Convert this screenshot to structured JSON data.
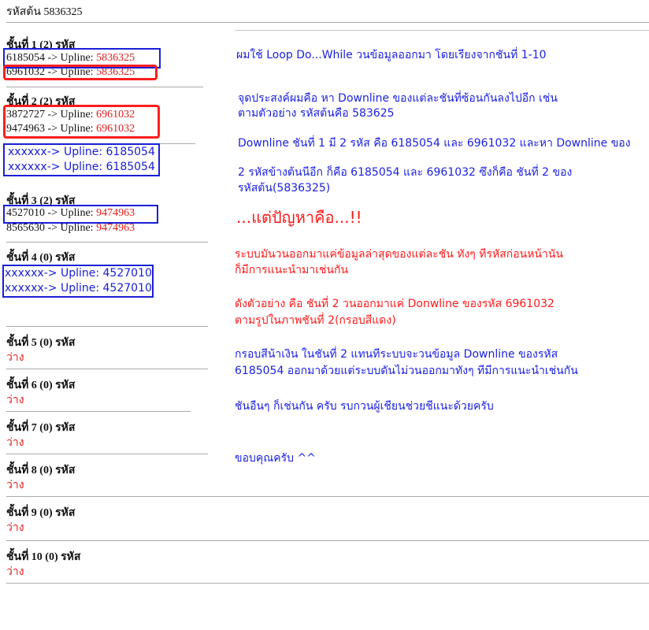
{
  "header": {
    "root_code_label": "รหัสต้น 5836325"
  },
  "levels": [
    {
      "title": "ชั้นที่ 1 (2) รหัส",
      "rows": [
        {
          "code": "6185054 -> Upline: ",
          "upline": "5836325"
        },
        {
          "code": "6961032 -> Upline: ",
          "upline": "5836325"
        }
      ]
    },
    {
      "title": "ชั้นที่ 2 (2) รหัส",
      "rows": [
        {
          "code": "3872727 -> Upline: ",
          "upline": "6961032"
        },
        {
          "code": "9474963 -> Upline: ",
          "upline": "6961032"
        }
      ],
      "overlay_rows": [
        "xxxxxx-> Upline: 6185054",
        "xxxxxx-> Upline: 6185054"
      ]
    },
    {
      "title": "ชั้นที่ 3 (2) รหัส",
      "rows": [
        {
          "code": "4527010 -> Upline: ",
          "upline": "9474963"
        },
        {
          "code": "8565630 -> Upline: ",
          "upline": "9474963"
        }
      ]
    },
    {
      "title": "ชั้นที่ 4 (0) รหัส",
      "overlay_rows": [
        "xxxxxx-> Upline: 4527010",
        "xxxxxx-> Upline: 4527010"
      ]
    },
    {
      "title": "ชั้นที่ 5 (0) รหัส",
      "empty": "ว่าง"
    },
    {
      "title": "ชั้นที่ 6 (0) รหัส",
      "empty": "ว่าง"
    },
    {
      "title": "ชั้นที่ 7 (0) รหัส",
      "empty": "ว่าง"
    },
    {
      "title": "ชั้นที่ 8 (0) รหัส",
      "empty": "ว่าง"
    },
    {
      "title": "ชั้นที่ 9 (0) รหัส",
      "empty": "ว่าง"
    },
    {
      "title": "ชั้นที่ 10 (0) รหัส",
      "empty": "ว่าง"
    }
  ],
  "notes": {
    "p1": "ผมใช้ Loop Do...While วนข้อมูลออกมา โดยเรียงจากชันที่ 1-10",
    "p2a": "จุดประสงค์ผมคือ หา Downline ของแต่ละชันที่ซ้อนกันลงไปอีก เช่น",
    "p2b": "ตามตัวอย่าง รหัสต้นคือ 583625",
    "p3": "Downline ชันที่ 1 มี 2 รหัส คือ 6185054 และ 6961032 และหา Downline ของ",
    "p4a": "2 รหัสข้างต้นนีอีก ก็คือ 6185054 และ 6961032 ซึงก็คือ ชันที่ 2 ของ",
    "p4b": "รหัสต้น(5836325)",
    "problem": "...แต่ปัญหาคือ...!!",
    "p5a": "ระบบมันวนออกมาแค่ข้อมูลล่าสุดของแต่ละชัน ทังๆ ทีรหัสก่อนหน้านัน",
    "p5b": "ก็มีการแนะนำมาเช่นกัน",
    "p6a": "ดังตัวอย่าง คือ ชันที่ 2 วนออกมาแค่ Donwline ของรหัส 6961032",
    "p6b": "ตามรูปในภาพชันที่ 2(กรอบสีแดง)",
    "p7a": "กรอบสีน้าเงิน ในชันที่ 2 แทนทีระบบจะวนข้อมูล Downline ของรหัส",
    "p7b": "6185054 ออกมาด้วยแต่ระบบดันไม่วนออกมาทังๆ ทีมีการแนะนำเช่นกัน",
    "p8": "ชันอืนๆ ก็เช่นกัน ครับ  รบกวนผู้เชียนช่วยชีแนะด้วยครับ",
    "p9": "ขอบคุณครับ ^^"
  },
  "colors": {
    "annotation_blue": "#1a20d6",
    "annotation_red": "#ff1e1e",
    "upline_red": "#e31b1b"
  }
}
